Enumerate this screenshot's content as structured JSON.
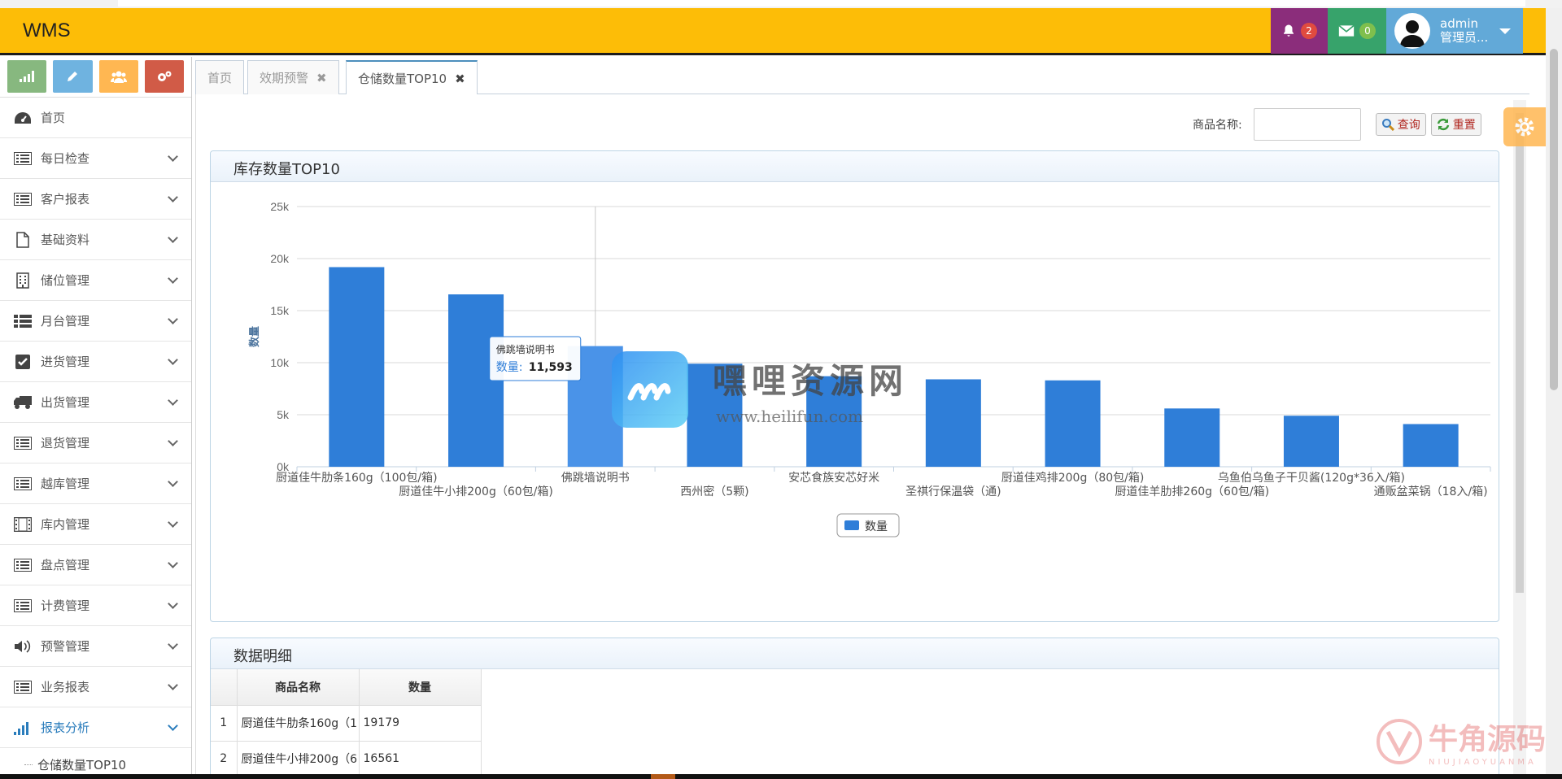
{
  "header": {
    "brand": "WMS",
    "notifications": "2",
    "messages": "0",
    "user_name": "admin",
    "user_role": "管理员..."
  },
  "sidebar": {
    "items": [
      {
        "label": "首页",
        "icon": "dashboard-icon"
      },
      {
        "label": "每日检查",
        "icon": "list-icon"
      },
      {
        "label": "客户报表",
        "icon": "list-icon"
      },
      {
        "label": "基础资料",
        "icon": "file-icon"
      },
      {
        "label": "储位管理",
        "icon": "building-icon"
      },
      {
        "label": "月台管理",
        "icon": "list-ul-icon"
      },
      {
        "label": "进货管理",
        "icon": "check-square-icon"
      },
      {
        "label": "出货管理",
        "icon": "truck-icon"
      },
      {
        "label": "退货管理",
        "icon": "list-icon"
      },
      {
        "label": "越库管理",
        "icon": "list-icon"
      },
      {
        "label": "库内管理",
        "icon": "film-icon"
      },
      {
        "label": "盘点管理",
        "icon": "list-icon"
      },
      {
        "label": "计费管理",
        "icon": "list-icon"
      },
      {
        "label": "预警管理",
        "icon": "volume-icon"
      },
      {
        "label": "业务报表",
        "icon": "list-icon"
      },
      {
        "label": "报表分析",
        "icon": "signal-icon"
      }
    ],
    "sub_item": "仓储数量TOP10"
  },
  "tabs": [
    {
      "label": "首页"
    },
    {
      "label": "效期预警"
    },
    {
      "label": "仓储数量TOP10"
    }
  ],
  "search": {
    "label": "商品名称:",
    "value": "",
    "query_button": "查询",
    "reset_button": "重置"
  },
  "panel1": {
    "title": "库存数量TOP10"
  },
  "panel2": {
    "title": "数据明细",
    "columns": [
      "商品名称",
      "数量"
    ],
    "rows": [
      {
        "index": "1",
        "name": "厨道佳牛肋条160g（1",
        "qty": "19179"
      },
      {
        "index": "2",
        "name": "厨道佳牛小排200g（6",
        "qty": "16561"
      }
    ]
  },
  "watermark": {
    "title": "嘿哩资源网",
    "url": "www.heilifun.com",
    "corner_title": "牛角源码",
    "corner_sub": "NIUJIAOYUANMA"
  },
  "colors": {
    "header": "#fdbd07",
    "bar": "#2f7ed8",
    "bar_hover": "#4a93e8",
    "active": "#2b7dbc"
  },
  "chart_data": {
    "type": "bar",
    "title": "",
    "xlabel": "",
    "ylabel": "数量",
    "ylim": [
      0,
      25000
    ],
    "yticks": [
      "0k",
      "5k",
      "10k",
      "15k",
      "20k",
      "25k"
    ],
    "grid": true,
    "legend": "bottom",
    "categories": [
      "厨道佳牛肋条160g（100包/箱)",
      "厨道佳牛小排200g（60包/箱)",
      "佛跳墙说明书",
      "西州密（5颗)",
      "安芯食族安芯好米",
      "圣祺行保温袋（通)",
      "厨道佳鸡排200g（80包/箱)",
      "厨道佳羊肋排260g（60包/箱)",
      "乌鱼伯乌鱼子干贝酱(120g*36入/箱)",
      "通贩盆菜锅（18入/箱)"
    ],
    "series": [
      {
        "name": "数量",
        "values": [
          19179,
          16561,
          11593,
          9900,
          8700,
          8400,
          8300,
          5600,
          4900,
          4100
        ]
      }
    ],
    "tooltip": {
      "category": "佛跳墙说明书",
      "label": "数量",
      "value": "11,593"
    }
  }
}
